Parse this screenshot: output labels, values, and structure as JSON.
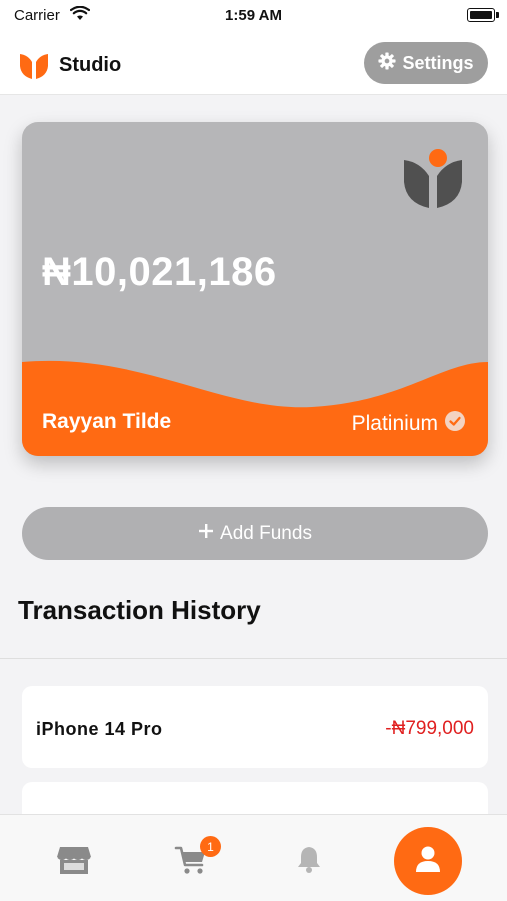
{
  "status_bar": {
    "carrier": "Carrier",
    "time": "1:59 AM"
  },
  "header": {
    "title": "Studio",
    "settings_label": "Settings"
  },
  "card": {
    "balance": "₦10,021,186",
    "holder_name": "Rayyan Tilde",
    "tier": "Platinium"
  },
  "add_funds": {
    "label": "Add Funds"
  },
  "transactions": {
    "title": "Transaction History",
    "items": [
      {
        "name": "iPhone 14 Pro",
        "amount": "-₦799,000"
      }
    ]
  },
  "tabbar": {
    "cart_badge": "1"
  },
  "colors": {
    "accent": "#ff6a13",
    "card_bg": "#b6b6b8",
    "negative": "#e02020"
  },
  "icons": [
    "wifi-icon",
    "battery-icon",
    "tulip-logo-icon",
    "gear-icon",
    "verified-check-icon",
    "plus-icon",
    "store-icon",
    "cart-icon",
    "bell-icon",
    "user-icon"
  ]
}
